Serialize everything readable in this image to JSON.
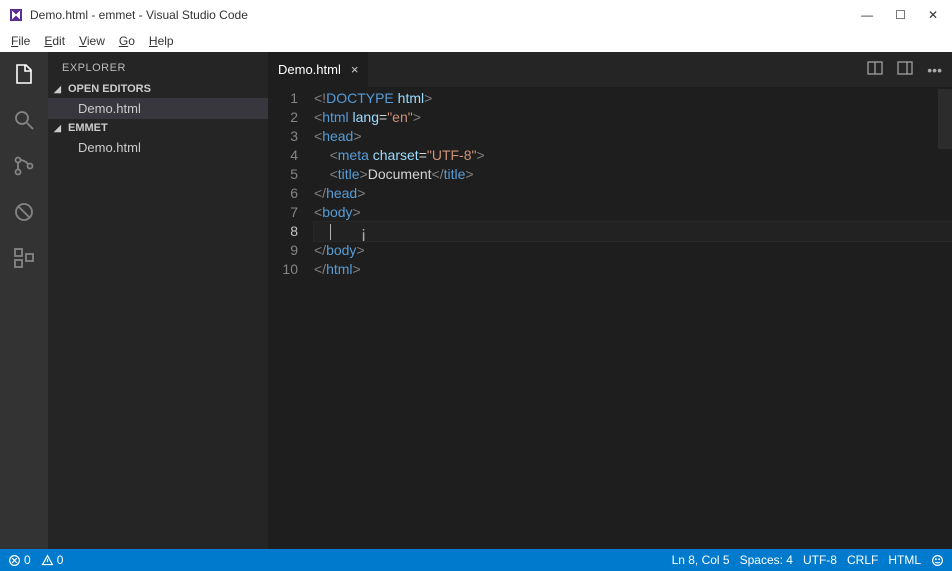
{
  "titlebar": {
    "title": "Demo.html - emmet - Visual Studio Code"
  },
  "menu": {
    "file": "File",
    "edit": "Edit",
    "view": "View",
    "go": "Go",
    "help": "Help"
  },
  "sidebar": {
    "title": "EXPLORER",
    "sections": {
      "open_editors": "OPEN EDITORS",
      "open_editors_file": "Demo.html",
      "workspace": "EMMET",
      "workspace_file": "Demo.html"
    }
  },
  "tabs": {
    "active": "Demo.html"
  },
  "editor": {
    "line_numbers": [
      "1",
      "2",
      "3",
      "4",
      "5",
      "6",
      "7",
      "8",
      "9",
      "10"
    ],
    "current_line_index": 7,
    "lines": [
      {
        "indent": 0,
        "tokens": [
          {
            "t": "br",
            "v": "<!"
          },
          {
            "t": "doctype",
            "v": "DOCTYPE "
          },
          {
            "t": "attr",
            "v": "html"
          },
          {
            "t": "br",
            "v": ">"
          }
        ]
      },
      {
        "indent": 0,
        "tokens": [
          {
            "t": "br",
            "v": "<"
          },
          {
            "t": "tag",
            "v": "html "
          },
          {
            "t": "attr",
            "v": "lang"
          },
          {
            "t": "txt",
            "v": "="
          },
          {
            "t": "str",
            "v": "\"en\""
          },
          {
            "t": "br",
            "v": ">"
          }
        ]
      },
      {
        "indent": 0,
        "tokens": [
          {
            "t": "br",
            "v": "<"
          },
          {
            "t": "tag",
            "v": "head"
          },
          {
            "t": "br",
            "v": ">"
          }
        ]
      },
      {
        "indent": 1,
        "tokens": [
          {
            "t": "br",
            "v": "<"
          },
          {
            "t": "tag",
            "v": "meta "
          },
          {
            "t": "attr",
            "v": "charset"
          },
          {
            "t": "txt",
            "v": "="
          },
          {
            "t": "str",
            "v": "\"UTF-8\""
          },
          {
            "t": "br",
            "v": ">"
          }
        ]
      },
      {
        "indent": 1,
        "tokens": [
          {
            "t": "br",
            "v": "<"
          },
          {
            "t": "tag",
            "v": "title"
          },
          {
            "t": "br",
            "v": ">"
          },
          {
            "t": "txt",
            "v": "Document"
          },
          {
            "t": "br",
            "v": "</"
          },
          {
            "t": "tag",
            "v": "title"
          },
          {
            "t": "br",
            "v": ">"
          }
        ]
      },
      {
        "indent": 0,
        "tokens": [
          {
            "t": "br",
            "v": "</"
          },
          {
            "t": "tag",
            "v": "head"
          },
          {
            "t": "br",
            "v": ">"
          }
        ]
      },
      {
        "indent": 0,
        "tokens": [
          {
            "t": "br",
            "v": "<"
          },
          {
            "t": "tag",
            "v": "body"
          },
          {
            "t": "br",
            "v": ">"
          }
        ]
      },
      {
        "indent": 1,
        "tokens": [],
        "cursor": true
      },
      {
        "indent": 0,
        "tokens": [
          {
            "t": "br",
            "v": "</"
          },
          {
            "t": "tag",
            "v": "body"
          },
          {
            "t": "br",
            "v": ">"
          }
        ]
      },
      {
        "indent": 0,
        "tokens": [
          {
            "t": "br",
            "v": "</"
          },
          {
            "t": "tag",
            "v": "html"
          },
          {
            "t": "br",
            "v": ">"
          }
        ]
      }
    ]
  },
  "statusbar": {
    "errors": "0",
    "warnings": "0",
    "position": "Ln 8, Col 5",
    "spaces": "Spaces: 4",
    "encoding": "UTF-8",
    "eol": "CRLF",
    "language": "HTML"
  }
}
